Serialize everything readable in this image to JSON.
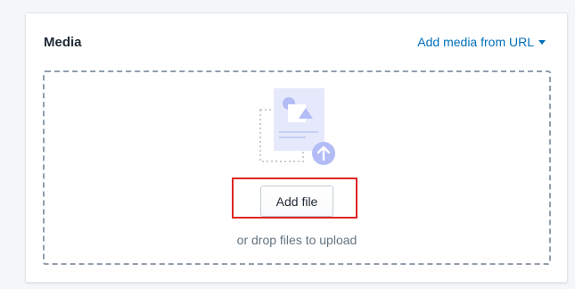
{
  "media_card": {
    "title": "Media",
    "add_from_url_label": "Add media from URL",
    "dropzone": {
      "add_file_label": "Add file",
      "drop_hint": "or drop files to upload"
    }
  },
  "colors": {
    "link": "#006fbb",
    "highlight": "#e02424",
    "illustration_fill": "#dfe3f8",
    "illustration_accent": "#b3bcf5"
  },
  "icons": [
    "chevron-down-icon",
    "upload-illustration-icon",
    "upload-arrow-icon"
  ]
}
